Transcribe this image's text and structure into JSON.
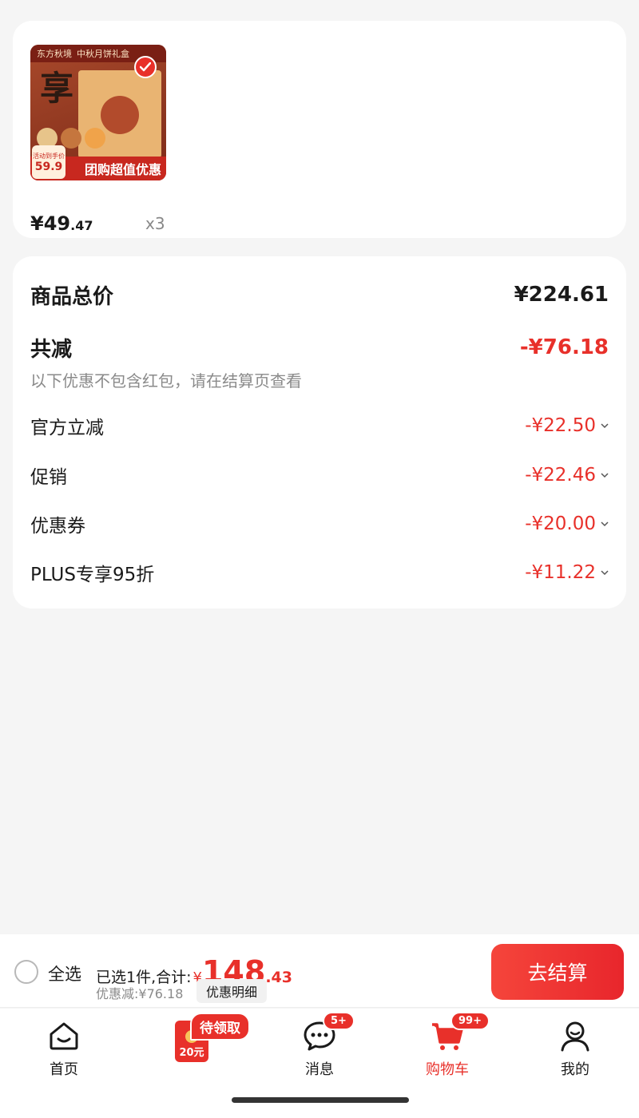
{
  "product": {
    "thumb_brand": "东方秋境",
    "thumb_title": "中秋月饼礼盒",
    "thumb_calligraphy": "享",
    "thumb_banner": "团购超值优惠",
    "thumb_price": "59.9",
    "thumb_price_label": "活动到手价",
    "price_int": "¥49",
    "price_dec": ".47",
    "qty": "x3"
  },
  "summary": {
    "total_label": "商品总价",
    "total_value": "¥224.61",
    "reduce_label": "共减",
    "reduce_value": "-¥76.18",
    "note": "以下优惠不包含红包，请在结算页查看",
    "items": [
      {
        "label": "官方立减",
        "value": "-¥22.50"
      },
      {
        "label": "促销",
        "value": "-¥22.46"
      },
      {
        "label": "优惠券",
        "value": "-¥20.00"
      },
      {
        "label": "PLUS专享95折",
        "value": "-¥11.22"
      }
    ]
  },
  "checkout": {
    "select_all": "全选",
    "selected_prefix": "已选1件,合计:",
    "currency": "¥",
    "total_int": "148",
    "total_dec": ".43",
    "discount_line": "优惠减:¥76.18",
    "detail_button": "优惠明细",
    "checkout_button": "去结算"
  },
  "tabbar": {
    "home": "首页",
    "redpack_amount": "20元",
    "redpack_badge": "待领取",
    "messages": "消息",
    "messages_badge": "5+",
    "cart": "购物车",
    "cart_badge": "99+",
    "me": "我的"
  },
  "colors": {
    "accent": "#e8302a",
    "muted": "#8a8a8a"
  },
  "icons": [
    "check-icon",
    "chevron-down-icon",
    "home-icon",
    "redpack-icon",
    "message-icon",
    "cart-icon",
    "user-icon"
  ]
}
